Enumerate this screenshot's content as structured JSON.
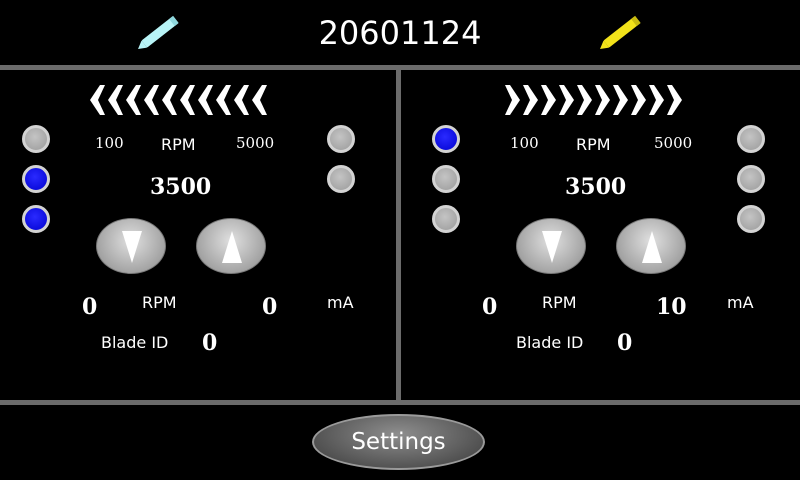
{
  "header": {
    "serial": "20601124",
    "left_pen_color": "#b8f4f7",
    "right_pen_color": "#f2e21a"
  },
  "colors": {
    "led_on": "#0000e0",
    "led_off": "#aaaaaa",
    "divider": "#6b6b6b"
  },
  "left": {
    "direction": "left",
    "rpm_min": "100",
    "rpm_label": "RPM",
    "rpm_max": "5000",
    "setpoint": "3500",
    "actual_rpm": "0",
    "actual_rpm_label": "RPM",
    "current": "0",
    "current_label": "mA",
    "blade_label": "Blade ID",
    "blade_id": "0",
    "leds_left": [
      "off",
      "on",
      "on"
    ],
    "leds_right": [
      "off",
      "off"
    ]
  },
  "right": {
    "direction": "right",
    "rpm_min": "100",
    "rpm_label": "RPM",
    "rpm_max": "5000",
    "setpoint": "3500",
    "actual_rpm": "0",
    "actual_rpm_label": "RPM",
    "current": "10",
    "current_label": "mA",
    "blade_label": "Blade ID",
    "blade_id": "0",
    "leds_left": [
      "on",
      "off",
      "off"
    ],
    "leds_right": [
      "off",
      "off",
      "off"
    ]
  },
  "footer": {
    "settings_label": "Settings"
  }
}
